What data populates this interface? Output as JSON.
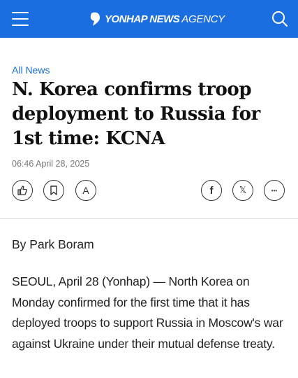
{
  "header": {
    "brand": "YONHAP NEWS",
    "brand_suffix": "AGENCY",
    "menu_icon": "hamburger-menu-icon",
    "search_icon": "search-icon",
    "background_color": "#1b6ee0"
  },
  "article": {
    "section": "All News",
    "headline": "N. Korea confirms troop deployment to Russia for 1st time: KCNA",
    "timestamp": "06:46 April 28, 2025",
    "actions": {
      "like_icon": "thumbs-up-icon",
      "bookmark_icon": "bookmark-icon",
      "font_size_label": "A",
      "facebook_label": "f",
      "x_label": "𝕏",
      "more_label": "•••"
    },
    "byline": "By Park Boram",
    "body": "SEOUL, April 28 (Yonhap) — North Korea on Monday confirmed for the first time that it has deployed troops to support Russia in Moscow's war against Ukraine under their mutual defense treaty."
  }
}
